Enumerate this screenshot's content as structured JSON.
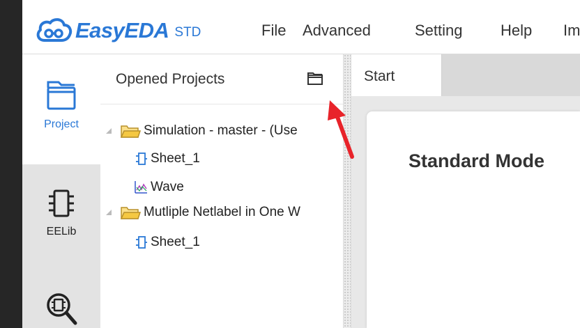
{
  "menubar": {
    "logo_text": "EasyEDA",
    "logo_edition": "STD",
    "items": [
      "File",
      "Advanced",
      "Setting",
      "Help",
      "Im"
    ]
  },
  "iconbar": {
    "items": [
      {
        "label": "Project",
        "icon": "project-folder-icon",
        "active": true
      },
      {
        "label": "EELib",
        "icon": "chip-icon",
        "active": false
      },
      {
        "label": "",
        "icon": "chip-search-icon",
        "active": false
      }
    ]
  },
  "panel": {
    "title": "Opened Projects",
    "tree": [
      {
        "label": "Simulation - master - (Use",
        "type": "project",
        "icon": "folder-icon",
        "expanded": true
      },
      {
        "label": "Sheet_1",
        "type": "schematic",
        "icon": "schematic-icon"
      },
      {
        "label": "Wave",
        "type": "waveform",
        "icon": "waveform-icon"
      },
      {
        "label": "Mutliple Netlabel in One W",
        "type": "project",
        "icon": "folder-icon",
        "expanded": true
      },
      {
        "label": "Sheet_1",
        "type": "schematic",
        "icon": "schematic-icon"
      }
    ]
  },
  "main": {
    "tab_label": "Start",
    "card_title": "Standard Mode"
  },
  "colors": {
    "brand": "#2a78d6",
    "annotation_arrow": "#e8232a",
    "folder": "#f2c94c"
  }
}
